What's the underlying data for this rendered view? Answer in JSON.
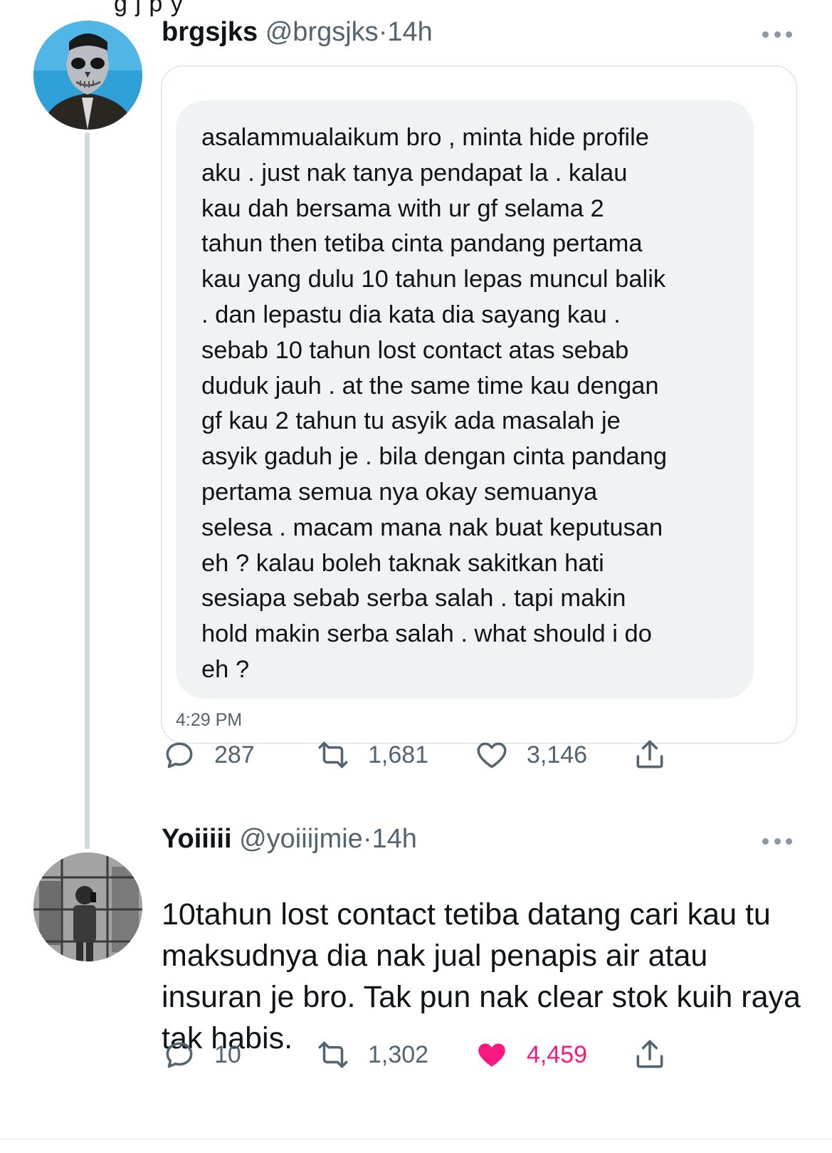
{
  "top_partial_text": "g j         p y",
  "tweets": [
    {
      "display_name": "brgsjks",
      "handle": "@brgsjks",
      "separator": "·",
      "time": "14h",
      "avatar_icon": "masked-person-avatar",
      "dm_message": "asalammualaikum bro , minta hide profile\naku . just nak tanya pendapat la . kalau\nkau dah bersama with ur gf selama 2\ntahun then tetiba cinta pandang pertama\nkau yang dulu 10 tahun lepas muncul balik\n. dan lepastu dia kata dia sayang kau .\nsebab 10 tahun lost contact atas sebab\nduduk jauh . at the same time kau dengan\ngf kau 2 tahun tu asyik ada masalah je\nasyik gaduh je . bila dengan cinta pandang\npertama semua nya okay semuanya\nselesa . macam mana nak buat keputusan\neh ? kalau boleh taknak sakitkan hati\nsesiapa sebab serba salah . tapi makin\nhold makin serba salah . what should i do\neh ?",
      "dm_time": "4:29 PM",
      "replies": "287",
      "retweets": "1,681",
      "likes": "3,146",
      "liked": false
    },
    {
      "display_name": "Yoiiiii",
      "handle": "@yoiiijmie",
      "separator": "·",
      "time": "14h",
      "avatar_icon": "mirror-selfie-avatar",
      "text": "10tahun lost contact tetiba datang cari kau tu maksudnya dia nak jual penapis air atau insuran je bro. Tak pun nak clear stok kuih raya tak habis.",
      "replies": "10",
      "retweets": "1,302",
      "likes": "4,459",
      "liked": true
    }
  ],
  "colors": {
    "text_primary": "#0f1419",
    "text_secondary": "#536471",
    "like_pink": "#f91880",
    "bubble_bg": "#eff3f4",
    "border": "#cfd9de"
  }
}
